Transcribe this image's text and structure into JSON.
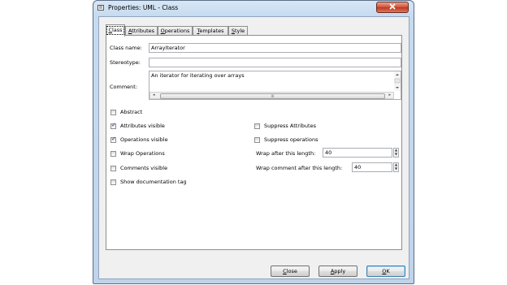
{
  "window": {
    "title": "Properties: UML - Class"
  },
  "tabs": [
    {
      "label": "Class",
      "mnemonic": "C",
      "rest": "lass"
    },
    {
      "label": "Attributes",
      "mnemonic": "A",
      "rest": "ttributes"
    },
    {
      "label": "Operations",
      "mnemonic": "O",
      "rest": "perations"
    },
    {
      "label": "Templates",
      "mnemonic": "T",
      "rest": "emplates"
    },
    {
      "label": "Style",
      "mnemonic": "S",
      "rest": "tyle"
    }
  ],
  "form": {
    "class_name_label": "Class name:",
    "class_name_value": "ArrayIterator",
    "stereotype_label": "Stereotype:",
    "stereotype_value": "",
    "comment_label": "Comment:",
    "comment_value": "An iterator for iterating over arrays",
    "scroll_grip": "III"
  },
  "checkboxes": {
    "abstract": {
      "label": "Abstract",
      "checked": false
    },
    "attributes_visible": {
      "label": "Attributes visible",
      "checked": true
    },
    "operations_visible": {
      "label": "Operations visible",
      "checked": true
    },
    "wrap_operations": {
      "label": "Wrap Operations",
      "checked": false
    },
    "comments_visible": {
      "label": "Comments visible",
      "checked": false
    },
    "show_documentation_tag": {
      "label": "Show documentation tag",
      "checked": false
    },
    "suppress_attributes": {
      "label": "Suppress Attributes",
      "checked": false
    },
    "suppress_operations": {
      "label": "Suppress operations",
      "checked": false
    }
  },
  "spinners": {
    "wrap_after_label": "Wrap after this length:",
    "wrap_after_value": "40",
    "wrap_comment_label": "Wrap comment after this length:",
    "wrap_comment_value": "40"
  },
  "buttons": {
    "close": {
      "mnemonic": "C",
      "rest": "lose"
    },
    "apply": {
      "mnemonic": "A",
      "rest": "pply"
    },
    "ok": {
      "mnemonic": "O",
      "rest": "K"
    }
  },
  "icons": {
    "app": "properties-app-icon",
    "close": "close-x-icon"
  },
  "colors": {
    "accent": "#3c7fb1",
    "close_button": "#c1371e",
    "checkmark": "#1a3a8a"
  }
}
